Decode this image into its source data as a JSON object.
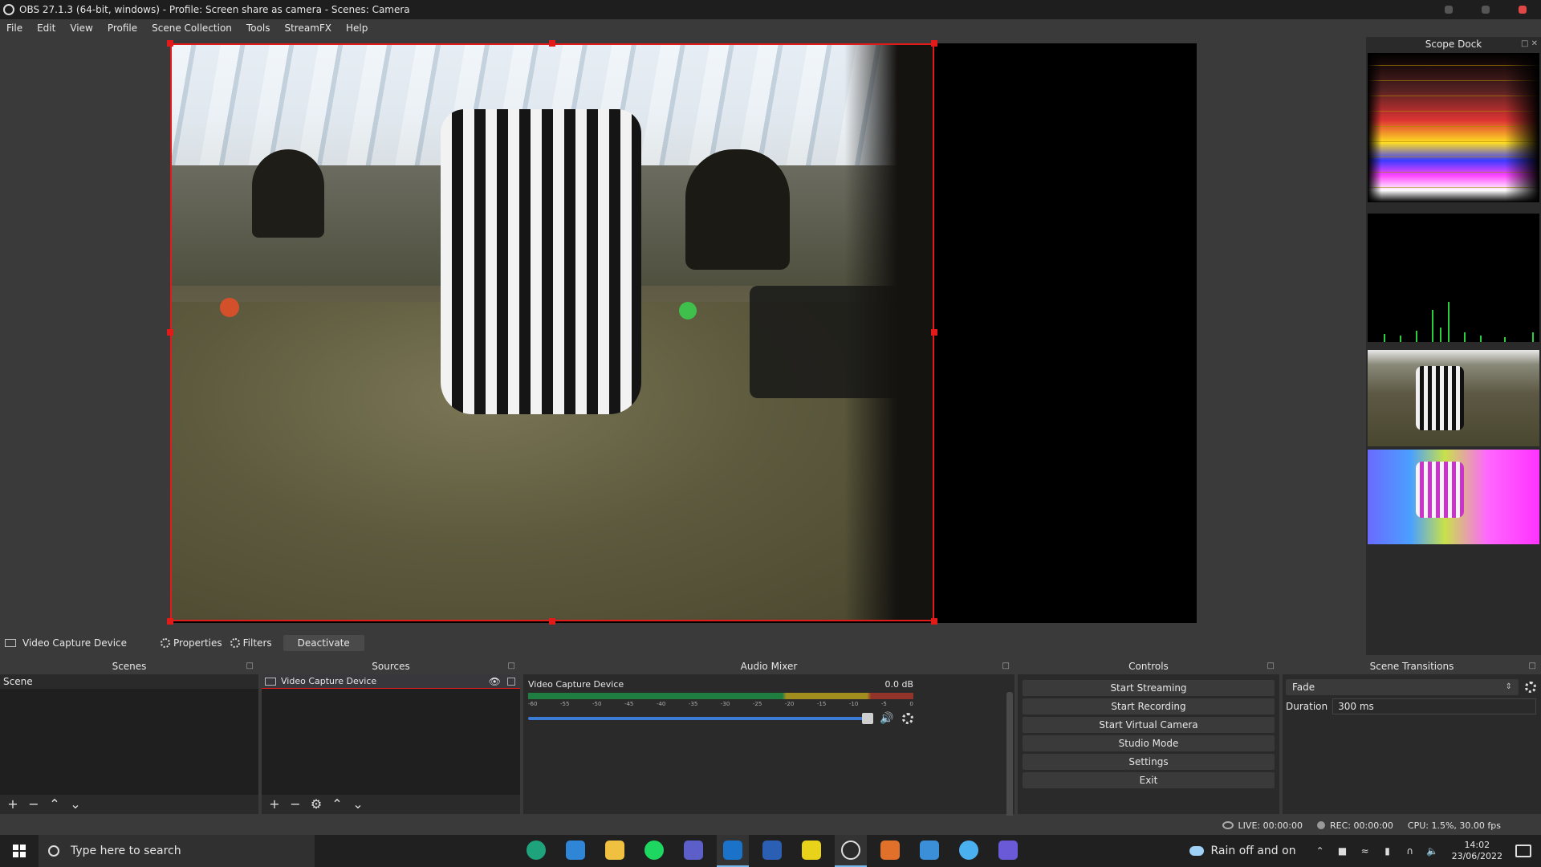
{
  "window": {
    "title": "OBS 27.1.3 (64-bit, windows) - Profile: Screen share as camera - Scenes: Camera"
  },
  "menu": [
    "File",
    "Edit",
    "View",
    "Profile",
    "Scene Collection",
    "Tools",
    "StreamFX",
    "Help"
  ],
  "scope_dock": {
    "title": "Scope Dock"
  },
  "context_bar": {
    "source_name": "Video Capture Device",
    "properties_label": "Properties",
    "filters_label": "Filters",
    "deactivate_label": "Deactivate"
  },
  "scenes": {
    "title": "Scenes",
    "items": [
      "Scene"
    ]
  },
  "sources": {
    "title": "Sources",
    "items": [
      "Video Capture Device"
    ]
  },
  "audio_mixer": {
    "title": "Audio Mixer",
    "channel_name": "Video Capture Device",
    "level": "0.0 dB",
    "ticks": [
      "-60",
      "-55",
      "-50",
      "-45",
      "-40",
      "-35",
      "-30",
      "-25",
      "-20",
      "-15",
      "-10",
      "-5",
      "0"
    ],
    "volume_fraction": 1.0
  },
  "controls": {
    "title": "Controls",
    "buttons": [
      "Start Streaming",
      "Start Recording",
      "Start Virtual Camera",
      "Studio Mode",
      "Settings",
      "Exit"
    ]
  },
  "scene_transitions": {
    "title": "Scene Transitions",
    "transition": "Fade",
    "duration_label": "Duration",
    "duration_value": "300 ms"
  },
  "status": {
    "live": "LIVE: 00:00:00",
    "rec": "REC: 00:00:00",
    "cpu": "CPU: 1.5%, 30.00 fps"
  },
  "taskbar": {
    "search_placeholder": "Type here to search",
    "weather": "Rain off and on",
    "time": "14:02",
    "date": "23/06/2022"
  },
  "colors": {
    "selection": "#e21a1a",
    "accent": "#3a7bd5"
  }
}
